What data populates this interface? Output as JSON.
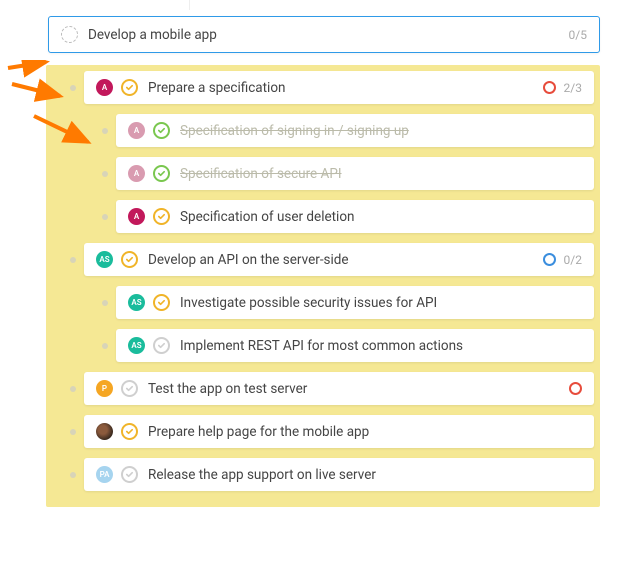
{
  "root": {
    "title": "Develop a mobile app",
    "count": "0/5"
  },
  "tasks": [
    {
      "avatar": "A",
      "avatarColor": "magenta",
      "status": "amber-check",
      "title": "Prepare a specification",
      "count": "2/3",
      "priority": "red",
      "children": [
        {
          "avatar": "A",
          "avatarColor": "magenta-faded",
          "status": "green-check",
          "title": "Specification of signing in / signing up",
          "done": true
        },
        {
          "avatar": "A",
          "avatarColor": "magenta-faded",
          "status": "green-check",
          "title": "Specification of secure API",
          "done": true
        },
        {
          "avatar": "A",
          "avatarColor": "magenta",
          "status": "amber-check",
          "title": "Specification of user deletion"
        }
      ]
    },
    {
      "avatar": "AS",
      "avatarColor": "teal",
      "status": "amber-check",
      "title": "Develop an API on the server-side",
      "count": "0/2",
      "priority": "blue",
      "children": [
        {
          "avatar": "AS",
          "avatarColor": "teal",
          "status": "amber-check",
          "title": "Investigate possible security issues for API"
        },
        {
          "avatar": "AS",
          "avatarColor": "teal",
          "status": "grey-check",
          "title": "Implement REST API for most common actions"
        }
      ]
    },
    {
      "avatar": "P",
      "avatarColor": "orange",
      "status": "grey-check",
      "title": "Test the app on test server",
      "priority": "red"
    },
    {
      "avatar": "",
      "avatarColor": "photo",
      "status": "amber-check",
      "title": "Prepare help page for the mobile app"
    },
    {
      "avatar": "PA",
      "avatarColor": "blue-light",
      "status": "grey-check",
      "title": "Release the app support on live server"
    }
  ]
}
